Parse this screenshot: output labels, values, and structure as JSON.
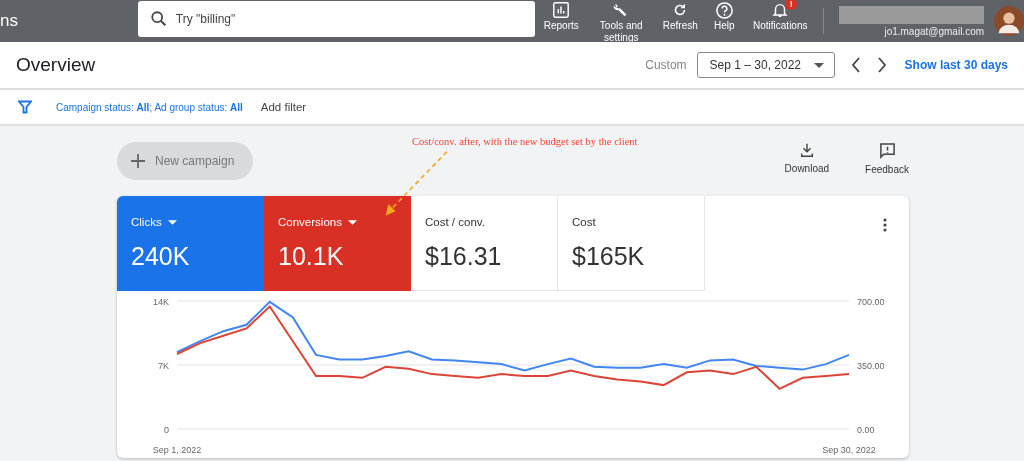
{
  "topbar": {
    "title_fragment": "ns",
    "search": {
      "placeholder": "Try \"billing\""
    },
    "actions": [
      {
        "kind": "reports",
        "label": "Reports"
      },
      {
        "kind": "tools",
        "label": "Tools and settings"
      },
      {
        "kind": "refresh",
        "label": "Refresh"
      },
      {
        "kind": "help",
        "label": "Help"
      },
      {
        "kind": "notifications",
        "label": "Notifications",
        "badge": "!"
      }
    ],
    "account": {
      "email": "jo1.magat@gmail.com"
    }
  },
  "header": {
    "title": "Overview",
    "range_label": "Custom",
    "date_range": "Sep 1 – 30, 2022",
    "show_last": "Show last 30 days"
  },
  "filter_bar": {
    "filter": "Campaign status: **All**; Ad group status: **All**",
    "add_filter": "Add filter"
  },
  "toolbar": {
    "new_campaign": "New campaign",
    "actions": [
      {
        "kind": "download",
        "label": "Download"
      },
      {
        "kind": "feedback",
        "label": "Feedback"
      }
    ]
  },
  "annotation": "Cost/conv. after, with the new budget set by the client",
  "scorecards": [
    {
      "label": "Clicks",
      "value": "240K",
      "selected": true,
      "color": "#1a73e8",
      "dropdown": true
    },
    {
      "label": "Conversions",
      "value": "10.1K",
      "selected": true,
      "color": "#d93025",
      "dropdown": true
    },
    {
      "label": "Cost / conv.",
      "value": "$16.31",
      "selected": false,
      "dropdown": false
    },
    {
      "label": "Cost",
      "value": "$165K",
      "selected": false,
      "dropdown": false
    }
  ],
  "chart_data": {
    "type": "line",
    "categories": [
      "Sep 1, 2022",
      null,
      null,
      null,
      null,
      null,
      null,
      null,
      null,
      null,
      null,
      null,
      null,
      null,
      null,
      null,
      null,
      null,
      null,
      null,
      null,
      null,
      null,
      null,
      null,
      null,
      null,
      null,
      null,
      "Sep 30, 2022"
    ],
    "ylim": [
      0,
      14000
    ],
    "yticks": [
      {
        "value": 0,
        "label": "0"
      },
      {
        "value": 7000,
        "label": "7K"
      },
      {
        "value": 14000,
        "label": "14K"
      }
    ],
    "y2lim": [
      0,
      700
    ],
    "y2ticks": [
      {
        "value": 0,
        "label": "0.00"
      },
      {
        "value": 350,
        "label": "350.00"
      },
      {
        "value": 700,
        "label": "700.00"
      }
    ],
    "series": [
      {
        "color": "#4285f4",
        "values": [
          8400,
          9600,
          10700,
          11400,
          13900,
          12200,
          8100,
          7600,
          7600,
          8000,
          8500,
          7600,
          7500,
          7300,
          7100,
          6400,
          7100,
          7700,
          6800,
          6700,
          6700,
          7100,
          6700,
          7500,
          7600,
          6900,
          6700,
          6500,
          7100,
          8100
        ]
      },
      {
        "color": "#db4437",
        "axis": "y2",
        "values": [
          410,
          470,
          510,
          550,
          670,
          480,
          290,
          290,
          280,
          340,
          330,
          300,
          290,
          280,
          300,
          290,
          290,
          320,
          290,
          270,
          260,
          240,
          310,
          320,
          300,
          340,
          220,
          280,
          290,
          300
        ]
      }
    ]
  }
}
